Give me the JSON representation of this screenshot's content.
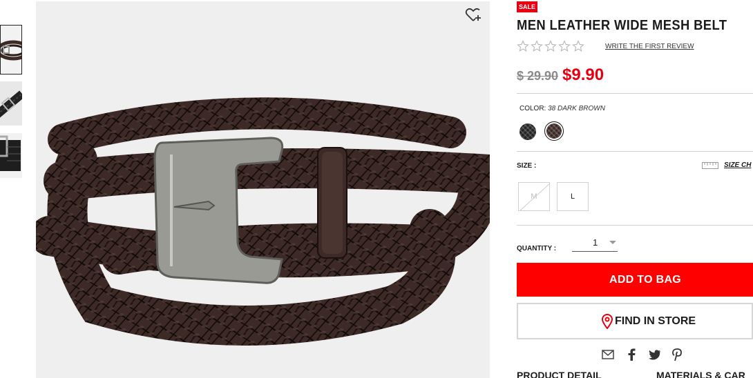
{
  "gallery": {
    "thumbnails": [
      "belt-coiled",
      "belt-buckle-closeup",
      "belt-buckle-detail"
    ],
    "wishlist_icon": "heart-plus-icon"
  },
  "product": {
    "badge": "SALE",
    "title": "MEN LEATHER WIDE MESH BELT",
    "rating_stars": 0,
    "review_link": "WRITE THE FIRST REVIEW",
    "original_price": "$ 29.90",
    "sale_price": "$9.90"
  },
  "color": {
    "label": "COLOR:",
    "selected": "38 DARK BROWN",
    "swatches": [
      "#222222",
      "#3a2724"
    ]
  },
  "size": {
    "label": "SIZE :",
    "chart_link": "SIZE CH",
    "options": [
      {
        "label": "M",
        "available": false
      },
      {
        "label": "L",
        "available": true
      }
    ]
  },
  "quantity": {
    "label": "QUANTITY :",
    "value": "1"
  },
  "actions": {
    "add_to_bag": "ADD TO BAG",
    "find_in_store": "FIND IN STORE"
  },
  "share_icons": [
    "mail-icon",
    "facebook-icon",
    "twitter-icon",
    "pinterest-icon"
  ],
  "tabs": [
    "PRODUCT DETAIL",
    "MATERIALS & CAR"
  ],
  "colors": {
    "accent": "#e60012",
    "button": "#ff0000",
    "belt": "#3d2a26"
  }
}
